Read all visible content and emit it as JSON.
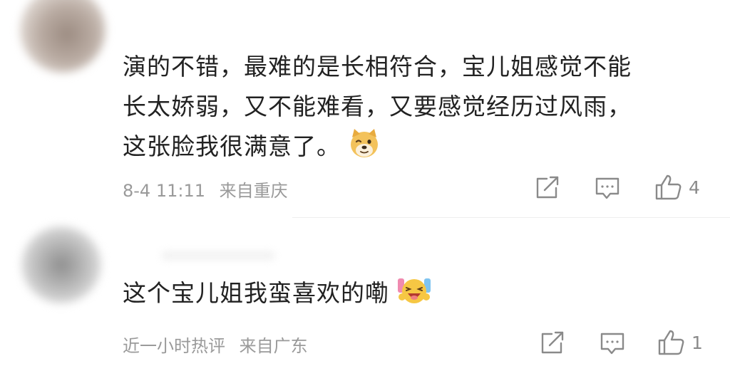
{
  "comments": [
    {
      "text_lines": [
        "演的不错，最难的是长相符合，宝儿姐感觉不能",
        "长太娇弱，又不能难看，又要感觉经历过风雨，",
        "这张脸我很满意了。"
      ],
      "emoji_icon": "doge-emoji-icon",
      "time": "8-4 11:11",
      "location": "来自重庆",
      "likes": "4"
    },
    {
      "text_lines": [
        "这个宝儿姐我蛮喜欢的嘞"
      ],
      "emoji_icon": "laughing-cheer-emoji-icon",
      "time": "近一小时热评",
      "location": "来自广东",
      "likes": "1"
    }
  ],
  "icons": {
    "share": "share-icon",
    "reply": "comment-reply-icon",
    "like": "thumbs-up-icon"
  },
  "colors": {
    "text": "#222222",
    "meta": "#9a9a9a",
    "icon": "#8a8a8a"
  }
}
